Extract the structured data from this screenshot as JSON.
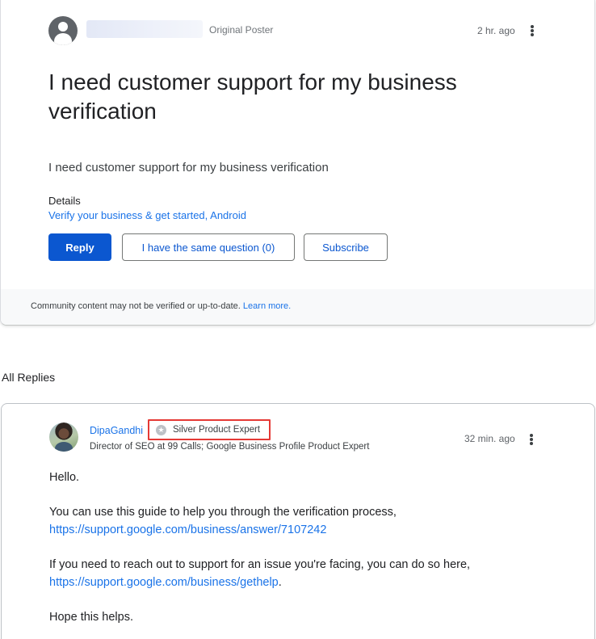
{
  "post": {
    "op_badge": "Original Poster",
    "timestamp": "2 hr. ago",
    "title": "I need customer support for my business verification",
    "body": "I need customer support for my business verification",
    "details_label": "Details",
    "details_links": "Verify your business & get started, Android",
    "buttons": {
      "reply": "Reply",
      "same_question": "I have the same question (0)",
      "subscribe": "Subscribe"
    },
    "disclaimer": {
      "text": "Community content may not be verified or up-to-date.",
      "link": "Learn more."
    }
  },
  "replies_header": "All Replies",
  "reply": {
    "author": "DipaGandhi",
    "badge_icon": "★",
    "badge": "Silver Product Expert",
    "author_title": "Director of SEO at 99 Calls; Google Business Profile Product Expert",
    "timestamp": "32 min. ago",
    "greeting": "Hello.",
    "para1_text": "You can use this guide to help you through the verification process,",
    "para1_link": "https://support.google.com/business/answer/7107242",
    "para2_text": "If you need to reach out to support for an issue you're facing, you can do so here,",
    "para2_link": "https://support.google.com/business/gethelp",
    "para2_end": ".",
    "closing": "Hope this helps."
  },
  "colors": {
    "primary_button": "#0b57d0",
    "link": "#1a73e8",
    "badge_highlight": "#e53935"
  }
}
